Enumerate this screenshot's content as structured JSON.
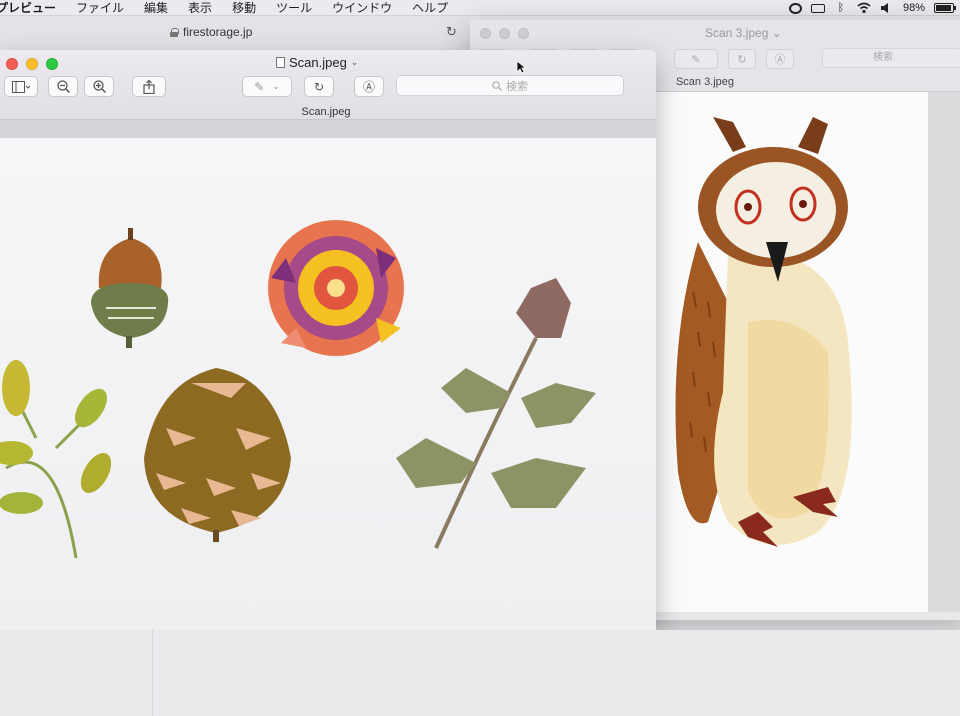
{
  "menubar": {
    "items": [
      "プレビュー",
      "ファイル",
      "編集",
      "表示",
      "移動",
      "ツール",
      "ウインドウ",
      "ヘルプ"
    ],
    "battery_percent": "98%",
    "battery_level": 0.98,
    "icons": [
      "creative-cloud-icon",
      "airplay-icon",
      "bluetooth-icon",
      "wifi-icon",
      "volume-icon",
      "battery-icon"
    ]
  },
  "browser": {
    "url": "firestorage.jp"
  },
  "back_window": {
    "title": "Scan 3.jpeg",
    "subtitle": "Scan 3.jpeg",
    "search_placeholder": "検索"
  },
  "front_window": {
    "title": "Scan.jpeg",
    "subtitle": "Scan.jpeg",
    "search_placeholder": "検索",
    "toolbar": [
      "sidebar-toggle",
      "zoom-out",
      "zoom-in",
      "share",
      "markup-pen",
      "rotate",
      "annotate"
    ]
  },
  "colors": {
    "close": "#f35d55",
    "minimize": "#f9be30",
    "maximize": "#2dca42"
  }
}
